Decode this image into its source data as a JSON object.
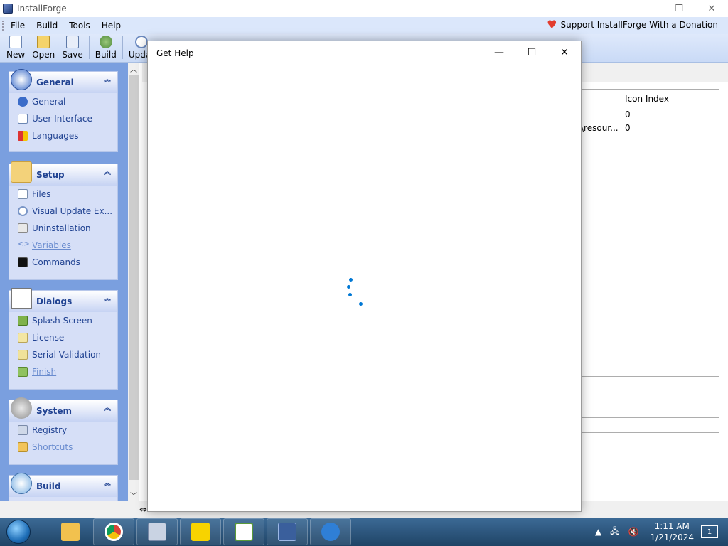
{
  "app": {
    "title": "InstallForge"
  },
  "window_controls": {
    "minimize": "—",
    "restore": "❐",
    "close": "✕"
  },
  "menu": {
    "items": [
      "File",
      "Build",
      "Tools",
      "Help"
    ],
    "donate": "Support InstallForge With a Donation"
  },
  "toolbar": {
    "new": "New",
    "open": "Open",
    "save": "Save",
    "build": "Build",
    "update": "Updat"
  },
  "sidebar": {
    "groups": [
      {
        "title": "General",
        "items": [
          {
            "label": "General"
          },
          {
            "label": "User Interface"
          },
          {
            "label": "Languages"
          }
        ]
      },
      {
        "title": "Setup",
        "items": [
          {
            "label": "Files"
          },
          {
            "label": "Visual Update Ex..."
          },
          {
            "label": "Uninstallation"
          },
          {
            "label": "Variables"
          },
          {
            "label": "Commands"
          }
        ]
      },
      {
        "title": "Dialogs",
        "items": [
          {
            "label": "Splash Screen"
          },
          {
            "label": "License"
          },
          {
            "label": "Serial Validation"
          },
          {
            "label": "Finish"
          }
        ]
      },
      {
        "title": "System",
        "items": [
          {
            "label": "Registry"
          },
          {
            "label": "Shortcuts"
          }
        ]
      },
      {
        "title": "Build",
        "items": []
      }
    ]
  },
  "list": {
    "column": "Icon Index",
    "rows": [
      {
        "path": "",
        "index": "0"
      },
      {
        "path": "\\resour...",
        "index": "0"
      }
    ]
  },
  "dialog": {
    "title": "Get Help",
    "minimize": "—",
    "maximize": "☐",
    "close": "✕"
  },
  "taskbar": {
    "time": "1:11 AM",
    "date": "1/21/2024",
    "notifications": "1"
  },
  "colors": {
    "sidebar_bg": "#7a9fdf",
    "group_title": "#214392",
    "spinner": "#0078d4",
    "taskbar": "#2a5681"
  }
}
